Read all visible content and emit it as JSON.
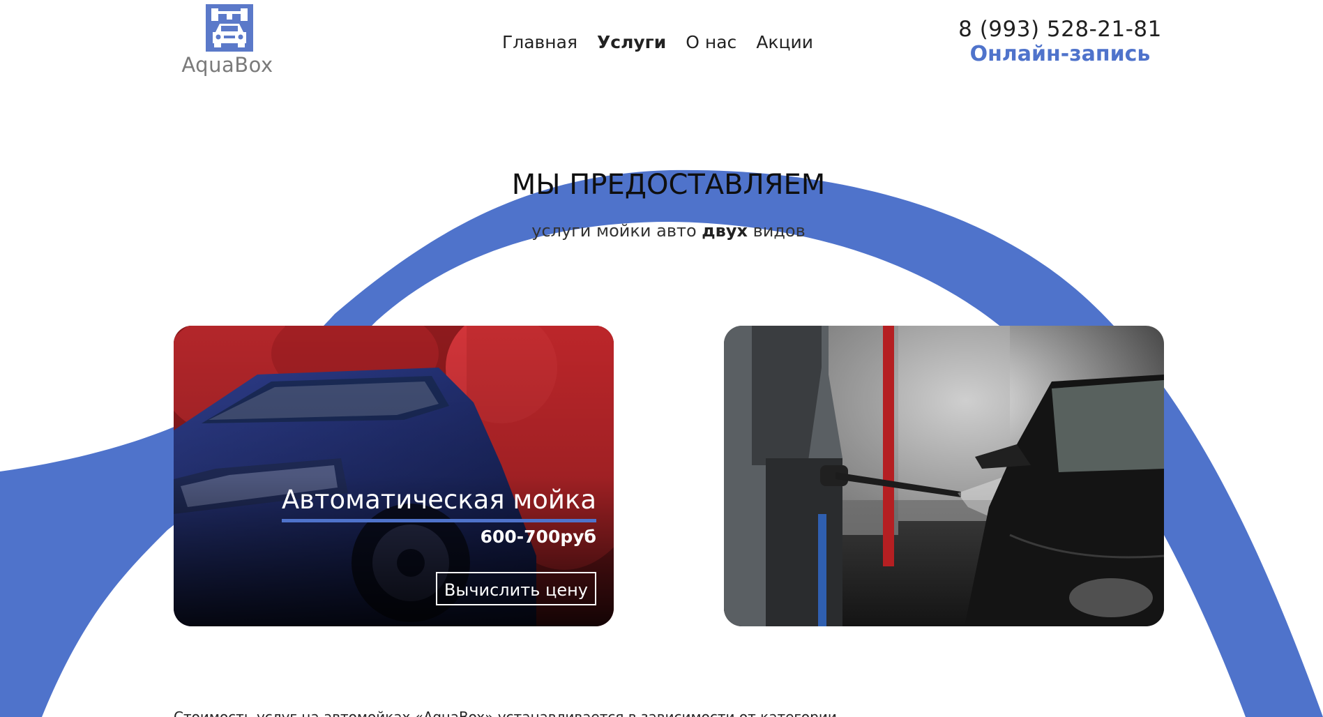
{
  "brand": {
    "name": "AquaBox",
    "accent_color": "#4f73cb"
  },
  "nav": {
    "items": [
      {
        "label": "Главная",
        "active": false
      },
      {
        "label": "Услуги",
        "active": true
      },
      {
        "label": "О нас",
        "active": false
      },
      {
        "label": "Акции",
        "active": false
      }
    ]
  },
  "contacts": {
    "phone": "8 (993) 528-21-81",
    "booking_label": "Онлайн-запись"
  },
  "hero": {
    "title": "МЫ ПРЕДОСТАВЛЯЕМ",
    "subtitle_prefix": "услуги мойки авто ",
    "subtitle_bold": "двух",
    "subtitle_suffix": " видов"
  },
  "cards": [
    {
      "title": "Автоматическая мойка",
      "price": "600-700руб",
      "button_label": "Вычислить цену"
    },
    {
      "title": "",
      "price": "",
      "button_label": ""
    }
  ],
  "footer": {
    "text": "Стоимость услуг на автомойках «AquaBox» устанавливается в зависимости от категории"
  }
}
